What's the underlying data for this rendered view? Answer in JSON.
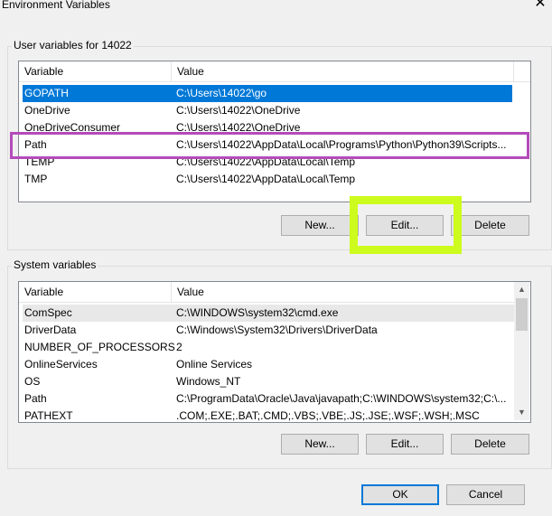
{
  "window": {
    "title": "Environment Variables",
    "close_glyph": "✕"
  },
  "user": {
    "group_label": "User variables for 14022",
    "headers": {
      "variable": "Variable",
      "value": "Value"
    },
    "rows": [
      {
        "variable": "GOPATH",
        "value": "C:\\Users\\14022\\go"
      },
      {
        "variable": "OneDrive",
        "value": "C:\\Users\\14022\\OneDrive"
      },
      {
        "variable": "OneDriveConsumer",
        "value": "C:\\Users\\14022\\OneDrive"
      },
      {
        "variable": "Path",
        "value": "C:\\Users\\14022\\AppData\\Local\\Programs\\Python\\Python39\\Scripts..."
      },
      {
        "variable": "TEMP",
        "value": "C:\\Users\\14022\\AppData\\Local\\Temp"
      },
      {
        "variable": "TMP",
        "value": "C:\\Users\\14022\\AppData\\Local\\Temp"
      }
    ],
    "buttons": {
      "new": "New...",
      "edit": "Edit...",
      "delete": "Delete"
    }
  },
  "system": {
    "group_label": "System variables",
    "headers": {
      "variable": "Variable",
      "value": "Value"
    },
    "rows": [
      {
        "variable": "ComSpec",
        "value": "C:\\WINDOWS\\system32\\cmd.exe"
      },
      {
        "variable": "DriverData",
        "value": "C:\\Windows\\System32\\Drivers\\DriverData"
      },
      {
        "variable": "NUMBER_OF_PROCESSORS",
        "value": "2"
      },
      {
        "variable": "OnlineServices",
        "value": "Online Services"
      },
      {
        "variable": "OS",
        "value": "Windows_NT"
      },
      {
        "variable": "Path",
        "value": "C:\\ProgramData\\Oracle\\Java\\javapath;C:\\WINDOWS\\system32;C:\\..."
      },
      {
        "variable": "PATHEXT",
        "value": ".COM;.EXE;.BAT;.CMD;.VBS;.VBE;.JS;.JSE;.WSF;.WSH;.MSC"
      }
    ],
    "buttons": {
      "new": "New...",
      "edit": "Edit...",
      "delete": "Delete"
    }
  },
  "footer": {
    "ok": "OK",
    "cancel": "Cancel"
  },
  "colors": {
    "selection": "#0078d7",
    "highlight_purple": "#b44bb9",
    "highlight_yellow": "#cdfb1d"
  },
  "icons": {
    "close": "close-icon",
    "scroll_up": "chevron-up-icon",
    "scroll_down": "chevron-down-icon"
  }
}
